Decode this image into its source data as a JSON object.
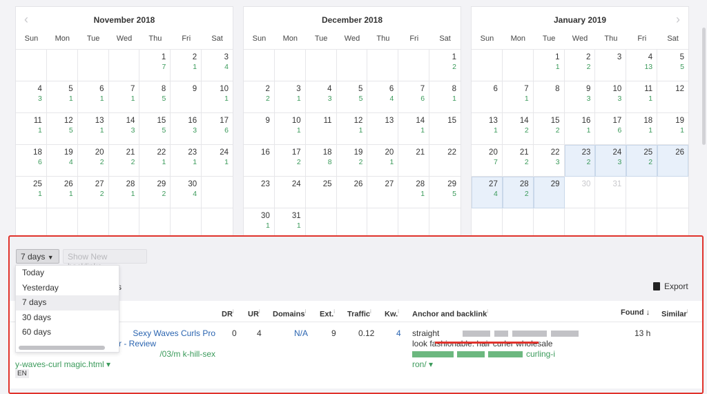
{
  "calendar": {
    "weekdays": [
      "Sun",
      "Mon",
      "Tue",
      "Wed",
      "Thu",
      "Fri",
      "Sat"
    ],
    "months": [
      {
        "title": "November 2018",
        "first_weekday": 4,
        "days": 30,
        "counts": {
          "1": 7,
          "2": 1,
          "3": 4,
          "4": 3,
          "5": 1,
          "6": 1,
          "7": 1,
          "8": 5,
          "10": 1,
          "11": 1,
          "12": 5,
          "13": 1,
          "14": 3,
          "15": 5,
          "16": 3,
          "17": 6,
          "18": 6,
          "19": 4,
          "20": 2,
          "21": 2,
          "22": 1,
          "23": 1,
          "24": 1,
          "25": 1,
          "26": 1,
          "27": 2,
          "28": 1,
          "29": 2,
          "30": 4
        },
        "selected": [],
        "disabled": []
      },
      {
        "title": "December 2018",
        "first_weekday": 6,
        "days": 31,
        "counts": {
          "1": 2,
          "2": 2,
          "3": 1,
          "4": 3,
          "5": 5,
          "6": 4,
          "7": 6,
          "8": 1,
          "10": 1,
          "12": 1,
          "14": 1,
          "17": 2,
          "18": 8,
          "19": 2,
          "20": 1,
          "28": 1,
          "29": 5,
          "30": 1,
          "31": 1
        },
        "selected": [],
        "disabled": []
      },
      {
        "title": "January 2019",
        "first_weekday": 2,
        "days": 31,
        "counts": {
          "1": 1,
          "2": 2,
          "4": 13,
          "5": 5,
          "7": 1,
          "9": 3,
          "10": 3,
          "11": 1,
          "13": 1,
          "14": 2,
          "15": 2,
          "16": 1,
          "17": 6,
          "18": 1,
          "19": 1,
          "20": 7,
          "21": 2,
          "22": 3,
          "23": 2,
          "24": 3,
          "25": 2,
          "27": 4,
          "28": 2
        },
        "selected": [
          23,
          24,
          25,
          26,
          27,
          28,
          29
        ],
        "disabled": [
          30,
          31
        ]
      }
    ],
    "prev_icon": "‹",
    "next_icon": "›"
  },
  "filters": {
    "period_value": "7 days",
    "show_new_label": "Show New backlinks",
    "options": [
      "Today",
      "Yesterday",
      "7 days",
      "30 days",
      "60 days"
    ],
    "active_option": "7 days",
    "behind_text": "s"
  },
  "export_label": "Export",
  "table": {
    "headers": {
      "dr": "DR",
      "ur": "UR",
      "domains": "Domains",
      "ext": "Ext.",
      "traffic": "Traffic",
      "kw": "Kw.",
      "anchor": "Anchor and backlink",
      "found": "Found ↓",
      "similar": "Similar"
    },
    "info_icon": "i",
    "row": {
      "title_line1": "Sexy Waves   Curls Pro",
      "title_line2": "r - Review",
      "url_line1": "/03/m  k-hill-sex",
      "url_line2": "y-waves-curl    magic.html ▾",
      "lang": "EN",
      "dr": "0",
      "ur": "4",
      "domains": "N/A",
      "ext": "9",
      "traffic": "0.12",
      "kw": "4",
      "anchor_line1": "straight",
      "anchor_line2": "look fashionable: hair curler wholesale",
      "backlink_end": "curling-i",
      "backlink_line2": "ron/ ▾",
      "found": "13 h"
    }
  },
  "colors": {
    "accent_green": "#3a9a5a",
    "link_blue": "#2a64b0",
    "highlight": "#e0322b",
    "selected_day": "#e8f0fa"
  }
}
